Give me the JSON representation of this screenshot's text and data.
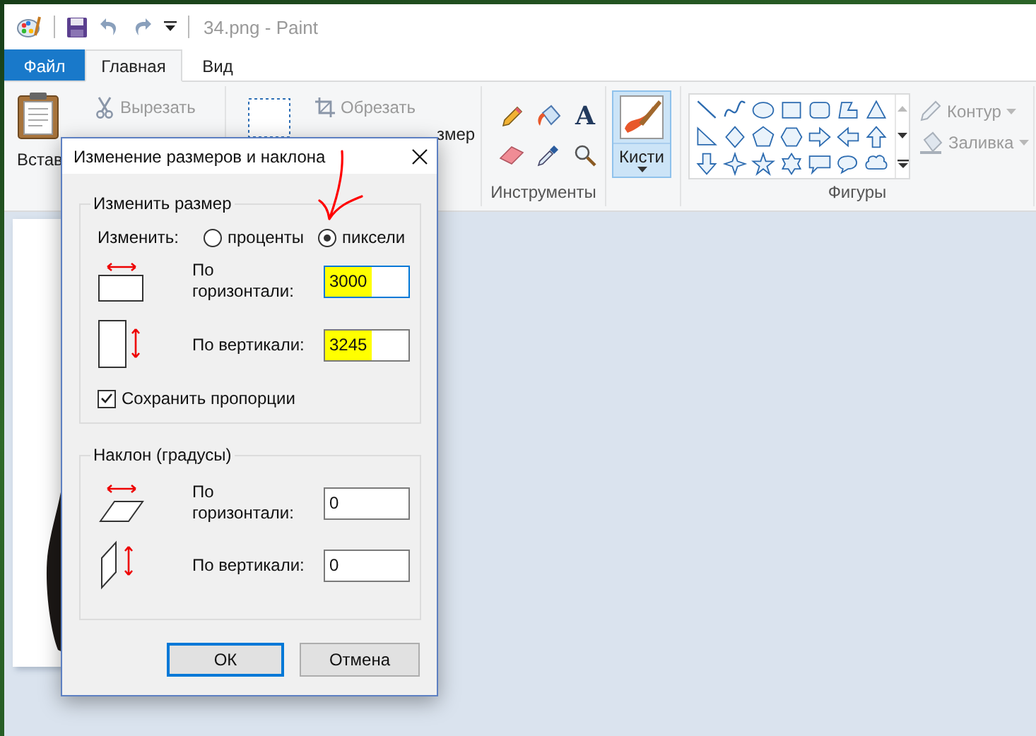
{
  "window": {
    "title": "34.png - Paint"
  },
  "tabs": [
    {
      "label": "Файл",
      "kind": "file",
      "selected": false
    },
    {
      "label": "Главная",
      "kind": "tab",
      "selected": true
    },
    {
      "label": "Вид",
      "kind": "tab",
      "selected": false
    }
  ],
  "ribbon": {
    "paste_label": "Встав",
    "cut_label": "Вырезать",
    "crop_label": "Обрезать",
    "resize_label": "змер",
    "tools_label": "Инструменты",
    "text_tool_glyph": "A",
    "brushes": {
      "label": "Кисти",
      "selected": true
    },
    "shapes_label": "Фигуры",
    "shape_options": [
      {
        "label": "Контур",
        "disabled": true
      },
      {
        "label": "Заливка",
        "disabled": true
      }
    ]
  },
  "dialog": {
    "title": "Изменение размеров и наклона",
    "resize": {
      "title": "Изменить размер",
      "by_label": "Изменить:",
      "options": [
        {
          "label": "проценты",
          "selected": false
        },
        {
          "label": "пиксели",
          "selected": true
        }
      ],
      "fields": [
        {
          "kind": "horizontal",
          "label": "По горизонтали:",
          "value": "3000",
          "highlighted": true,
          "focused": true
        },
        {
          "kind": "vertical",
          "label": "По вертикали:",
          "value": "3245",
          "highlighted": true,
          "focused": false
        }
      ],
      "keep_ratio": {
        "label": "Сохранить пропорции",
        "checked": true
      }
    },
    "skew": {
      "title": "Наклон (градусы)",
      "fields": [
        {
          "kind": "horizontal",
          "label": "По горизонтали:",
          "value": "0",
          "highlighted": false,
          "focused": false
        },
        {
          "kind": "vertical",
          "label": "По вертикали:",
          "value": "0",
          "highlighted": false,
          "focused": false
        }
      ]
    },
    "buttons": [
      {
        "label": "ОК",
        "focused": true
      },
      {
        "label": "Отмена",
        "focused": false
      }
    ]
  }
}
